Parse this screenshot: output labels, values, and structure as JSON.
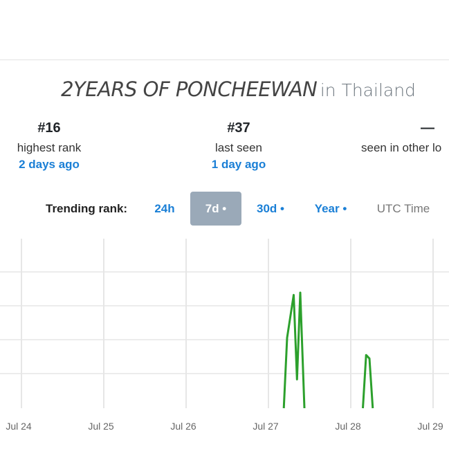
{
  "header": {
    "hashtag": "2YEARS OF PONCHEEWAN",
    "location": "in Thailand"
  },
  "stats": [
    {
      "value": "#16",
      "label": "highest rank",
      "sub": "2 days ago"
    },
    {
      "value": "#37",
      "label": "last seen",
      "sub": "1 day ago"
    },
    {
      "value": "—",
      "label": "seen in other lo",
      "sub": ""
    }
  ],
  "trending": {
    "label": "Trending rank:",
    "options": [
      "24h",
      "7d •",
      "30d •",
      "Year •",
      "UTC Time"
    ],
    "selected": "7d •"
  },
  "chart_data": {
    "type": "line",
    "x_ticks": [
      "Jul 24",
      "Jul 25",
      "Jul 26",
      "Jul 27",
      "Jul 28",
      "Jul 29"
    ],
    "grid": true,
    "series": [
      {
        "color": "#2ca02c",
        "points": [
          {
            "x": 3.17,
            "y": 0
          },
          {
            "x": 3.21,
            "y": 0.61
          },
          {
            "x": 3.29,
            "y": 0.98
          },
          {
            "x": 3.33,
            "y": 0.25
          },
          {
            "x": 3.37,
            "y": 1.0
          },
          {
            "x": 3.42,
            "y": 0.0
          }
        ]
      },
      {
        "color": "#2ca02c",
        "points": [
          {
            "x": 4.13,
            "y": 0
          },
          {
            "x": 4.17,
            "y": 0.46
          },
          {
            "x": 4.21,
            "y": 0.43
          },
          {
            "x": 4.25,
            "y": 0
          }
        ]
      }
    ]
  }
}
